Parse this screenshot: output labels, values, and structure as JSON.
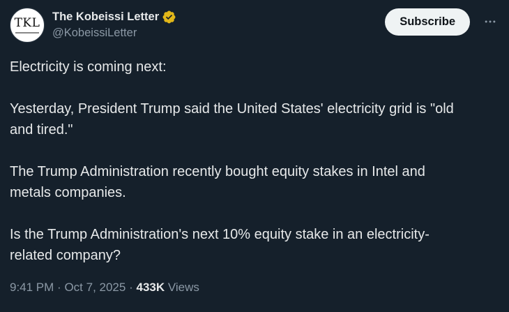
{
  "header": {
    "avatar_text": "TKL",
    "display_name": "The Kobeissi Letter",
    "handle": "@KobeissiLetter",
    "subscribe_label": "Subscribe",
    "verified_badge_color": "#e2b719",
    "more_icon": "more-horizontal-icon"
  },
  "tweet": {
    "paragraphs": [
      "Electricity is coming next:",
      "Yesterday, President Trump said the United States' electricity grid is \"old and tired.\"",
      "The Trump Administration recently bought equity stakes in Intel and metals companies.",
      "Is the Trump Administration's next 10% equity stake in an electricity-related company?"
    ],
    "lines": [
      "Electricity is coming next:",
      "Yesterday, President Trump said the United States' electricity grid is \"old",
      "and tired.\"",
      "The Trump Administration recently bought equity stakes in Intel and",
      "metals companies.",
      "Is the Trump Administration's next 10% equity stake in an electricity-",
      "related company?"
    ]
  },
  "meta": {
    "time": "9:41 PM",
    "separator": "·",
    "date": "Oct 7, 2025",
    "views_count": "433K",
    "views_label": "Views"
  },
  "colors": {
    "background": "#15202b",
    "primary_text": "#e7e9ea",
    "secondary_text": "#8b98a5",
    "subscribe_bg": "#eff3f4"
  }
}
